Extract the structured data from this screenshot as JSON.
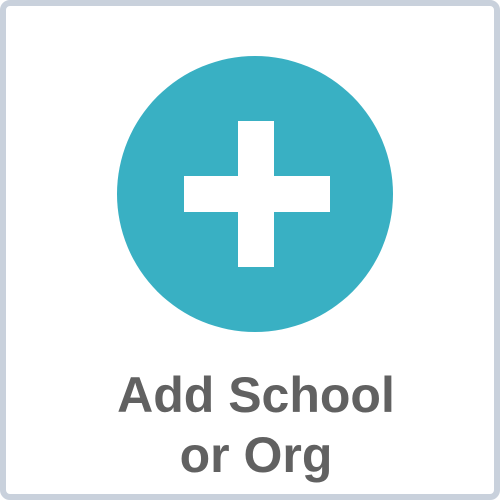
{
  "tile": {
    "label_line1": "Add School",
    "label_line2": "or Org",
    "icon": "plus-icon",
    "colors": {
      "accent": "#39b0c3",
      "text": "#616161",
      "border": "#c9d1dc",
      "background": "#ffffff"
    }
  }
}
